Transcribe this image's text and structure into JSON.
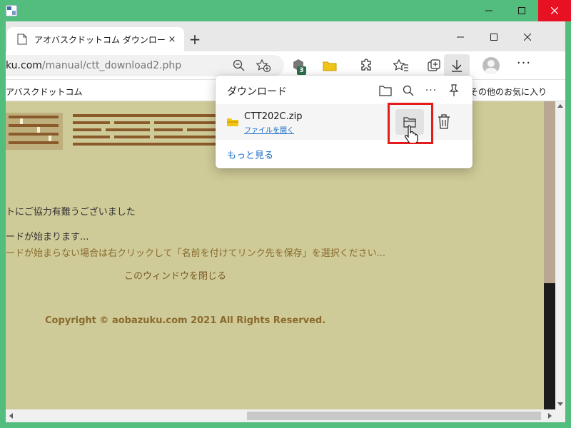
{
  "browser": {
    "tab_title": "アオバスクドットコム ダウンロード有難",
    "tab_close": "×",
    "new_tab": "+",
    "address_domain_partial": "ku.com",
    "address_path": "/manual/ctt_download2.php",
    "extension_badge": "3",
    "favorites_first": "アバスクドットコム",
    "favorites_other": "その他のお気に入り",
    "more_label": "···"
  },
  "page": {
    "line_thanks": "トにご協力有難うございました",
    "line_start": "ードが始まります...",
    "line_hint": "ードが始まらない場合は右クリックして「名前を付けてリンク先を保存」を選択ください...",
    "close_window": "このウィンドウを閉じる",
    "copyright": "Copyright © aobazuku.com 2021 All Rights Reserved."
  },
  "downloads": {
    "title": "ダウンロード",
    "item": {
      "filename": "CTT202C.zip",
      "action": "ファイルを開く"
    },
    "see_more": "もっと見る"
  },
  "colors": {
    "frame": "#52bd7c",
    "page_bg": "#cfcb98",
    "link": "#1a6dc7",
    "highlight": "#e41b1b",
    "close_red": "#e81123"
  },
  "icons": [
    "app-icon",
    "minimize-icon",
    "maximize-icon",
    "close-icon",
    "page-icon",
    "zoom-out-icon",
    "add-favorite-icon",
    "extension-icon",
    "collections-folder-icon",
    "puzzle-icon",
    "favorites-icon",
    "collections-icon",
    "download-icon",
    "profile-icon",
    "open-folder-icon",
    "search-icon",
    "pin-icon",
    "folder-icon",
    "trash-icon",
    "hand-cursor-icon"
  ]
}
